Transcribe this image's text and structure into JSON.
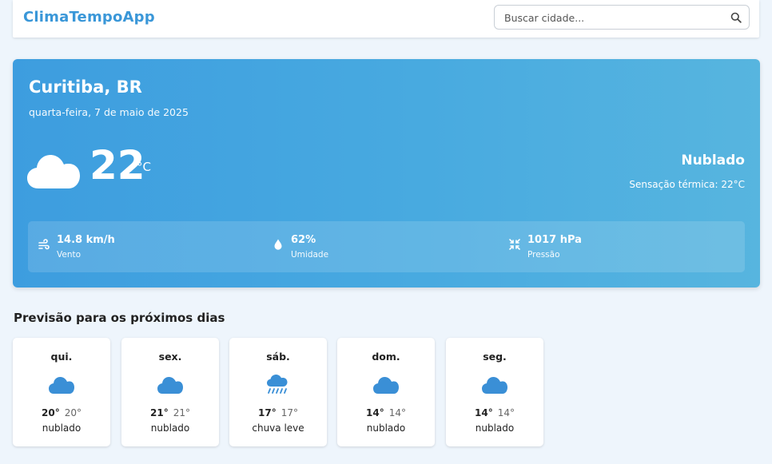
{
  "app": {
    "title": "ClimaTempoApp"
  },
  "search": {
    "placeholder": "Buscar cidade...",
    "value": ""
  },
  "current": {
    "city": "Curitiba, BR",
    "date": "quarta-feira, 7 de maio de 2025",
    "icon": "cloud-icon",
    "temperature": "22",
    "unit": "°C",
    "condition": "Nublado",
    "feels_like": "Sensação térmica: 22°C",
    "stats": [
      {
        "icon": "wind-icon",
        "value": "14.8 km/h",
        "label": "Vento"
      },
      {
        "icon": "droplet-icon",
        "value": "62%",
        "label": "Umidade"
      },
      {
        "icon": "pressure-icon",
        "value": "1017 hPa",
        "label": "Pressão"
      }
    ]
  },
  "forecast": {
    "title": "Previsão para os próximos dias",
    "days": [
      {
        "day": "qui.",
        "icon": "cloud-icon",
        "max": "20°",
        "min": "20°",
        "desc": "nublado"
      },
      {
        "day": "sex.",
        "icon": "cloud-icon",
        "max": "21°",
        "min": "21°",
        "desc": "nublado"
      },
      {
        "day": "sáb.",
        "icon": "rain-cloud-icon",
        "max": "17°",
        "min": "17°",
        "desc": "chuva leve"
      },
      {
        "day": "dom.",
        "icon": "cloud-icon",
        "max": "14°",
        "min": "14°",
        "desc": "nublado"
      },
      {
        "day": "seg.",
        "icon": "cloud-icon",
        "max": "14°",
        "min": "14°",
        "desc": "nublado"
      }
    ]
  },
  "colors": {
    "accent": "#3a97d8",
    "card_gradient_start": "#3d9ddf",
    "card_gradient_end": "#57b5df",
    "forecast_icon": "#3a8fd6",
    "background": "#eef5fc"
  }
}
